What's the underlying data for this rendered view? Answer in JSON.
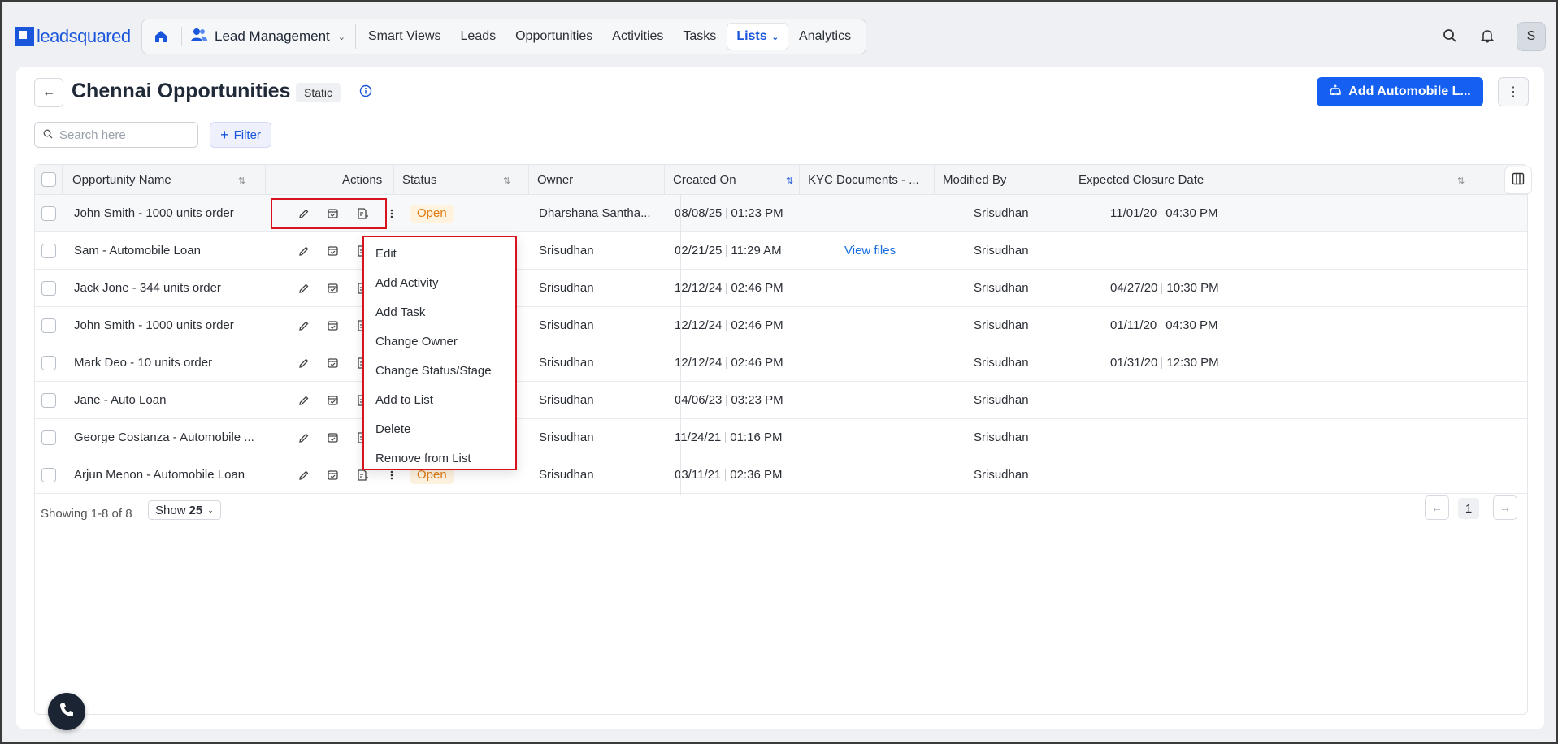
{
  "app": {
    "logo_text": "leadsquared"
  },
  "nav": {
    "module": "Lead Management",
    "items": [
      "Smart Views",
      "Leads",
      "Opportunities",
      "Activities",
      "Tasks",
      "Lists",
      "Analytics"
    ],
    "active": "Lists"
  },
  "user": {
    "avatar_initial": "S"
  },
  "page": {
    "title": "Chennai Opportunities",
    "badge": "Static",
    "primary_button": "Add Automobile L...",
    "search_placeholder": "Search here",
    "filter_label": "Filter"
  },
  "table": {
    "columns": [
      "Opportunity Name",
      "Actions",
      "Status",
      "Owner",
      "Created On",
      "KYC Documents - ...",
      "Modified By",
      "Expected Closure Date"
    ],
    "rows": [
      {
        "name": "John Smith - 1000 units order",
        "status": "Open",
        "owner": "Dharshana Santha...",
        "created_date": "08/08/25",
        "created_time": "01:23 PM",
        "kyc": "",
        "modified_by": "Srisudhan",
        "closure_date": "11/01/20",
        "closure_time": "04:30 PM"
      },
      {
        "name": "Sam - Automobile Loan",
        "status": "",
        "owner": "Srisudhan",
        "created_date": "02/21/25",
        "created_time": "11:29 AM",
        "kyc": "View files",
        "modified_by": "Srisudhan",
        "closure_date": "",
        "closure_time": ""
      },
      {
        "name": "Jack Jone - 344 units order",
        "status": "",
        "owner": "Srisudhan",
        "created_date": "12/12/24",
        "created_time": "02:46 PM",
        "kyc": "",
        "modified_by": "Srisudhan",
        "closure_date": "04/27/20",
        "closure_time": "10:30 PM"
      },
      {
        "name": "John Smith - 1000 units order",
        "status": "",
        "owner": "Srisudhan",
        "created_date": "12/12/24",
        "created_time": "02:46 PM",
        "kyc": "",
        "modified_by": "Srisudhan",
        "closure_date": "01/11/20",
        "closure_time": "04:30 PM"
      },
      {
        "name": "Mark Deo - 10 units order",
        "status": "",
        "owner": "Srisudhan",
        "created_date": "12/12/24",
        "created_time": "02:46 PM",
        "kyc": "",
        "modified_by": "Srisudhan",
        "closure_date": "01/31/20",
        "closure_time": "12:30 PM"
      },
      {
        "name": "Jane - Auto Loan",
        "status": "",
        "owner": "Srisudhan",
        "created_date": "04/06/23",
        "created_time": "03:23 PM",
        "kyc": "",
        "modified_by": "Srisudhan",
        "closure_date": "",
        "closure_time": ""
      },
      {
        "name": "George Costanza - Automobile ...",
        "status": "",
        "owner": "Srisudhan",
        "created_date": "11/24/21",
        "created_time": "01:16 PM",
        "kyc": "",
        "modified_by": "Srisudhan",
        "closure_date": "",
        "closure_time": ""
      },
      {
        "name": "Arjun Menon - Automobile Loan",
        "status": "Open",
        "owner": "Srisudhan",
        "created_date": "03/11/21",
        "created_time": "02:36 PM",
        "kyc": "",
        "modified_by": "Srisudhan",
        "closure_date": "",
        "closure_time": ""
      }
    ]
  },
  "context_menu": {
    "items": [
      "Edit",
      "Add Activity",
      "Add Task",
      "Change Owner",
      "Change Status/Stage",
      "Add to List",
      "Delete",
      "Remove from List"
    ]
  },
  "footer": {
    "showing": "Showing 1-8 of 8",
    "show_label": "Show",
    "show_value": "25",
    "current_page": "1"
  },
  "colors": {
    "accent": "#1560f0",
    "highlight": "#d7141d",
    "status_open": "#e07b12"
  }
}
